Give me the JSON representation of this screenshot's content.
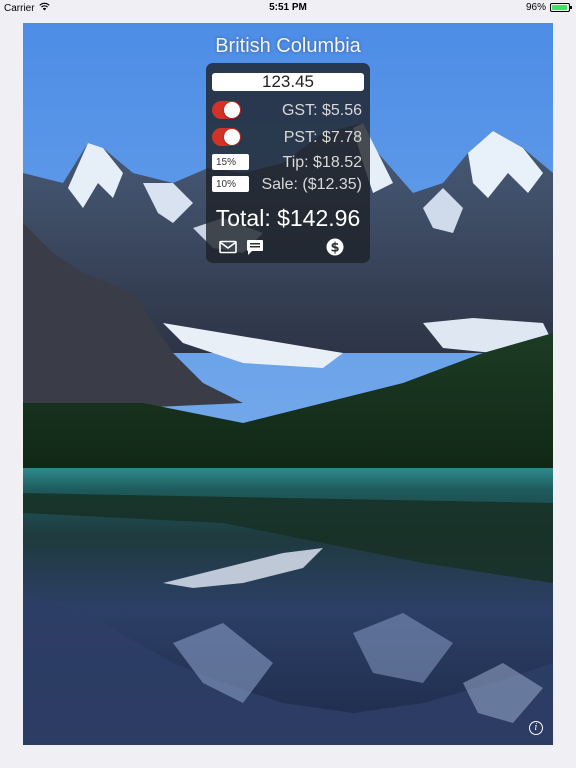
{
  "status_bar": {
    "carrier": "Carrier",
    "time": "5:51 PM",
    "battery_percent": "96%",
    "battery_level": 0.96,
    "battery_color": "#4cd964"
  },
  "region": {
    "title": "British Columbia"
  },
  "calculator": {
    "amount": "123.45",
    "gst": {
      "label": "GST: $5.56",
      "enabled": true
    },
    "pst": {
      "label": "PST: $7.78",
      "enabled": true
    },
    "tip": {
      "percent": "15%",
      "label": "Tip: $18.52"
    },
    "sale": {
      "percent": "10%",
      "label": "Sale: ($12.35)"
    },
    "total": "Total: $142.96",
    "toggle_color": "#d23228"
  },
  "actions": {
    "email_icon": "envelope-icon",
    "message_icon": "message-bubble-icon",
    "currency_icon": "dollar-circle-icon",
    "info_icon": "info-icon",
    "info_glyph": "i"
  }
}
